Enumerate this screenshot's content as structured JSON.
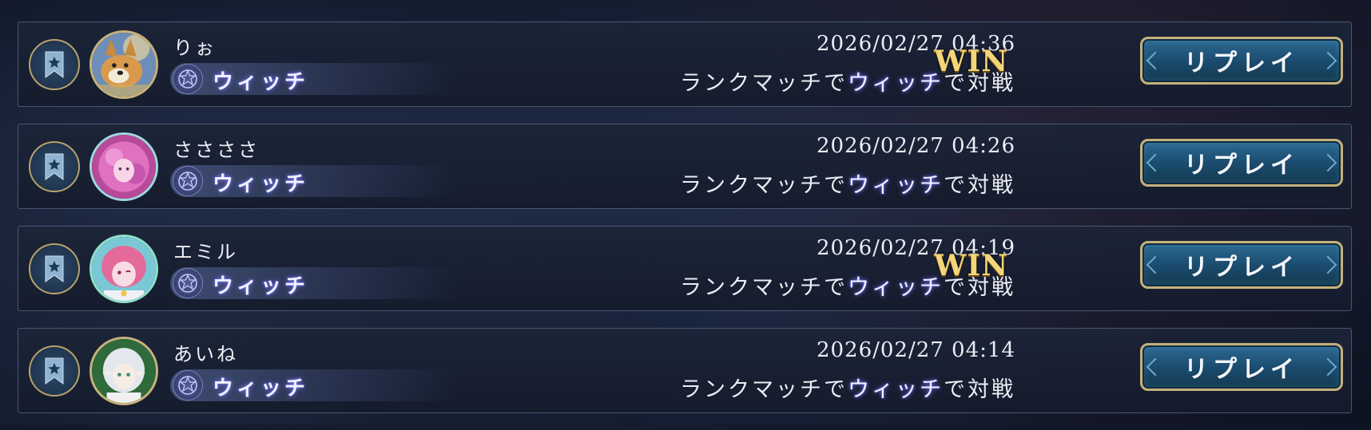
{
  "matches": [
    {
      "player": "りぉ",
      "class": "ウィッチ",
      "datetime": "2026/02/27 04:36",
      "match_prefix": "ランクマッチで",
      "match_class": "ウィッチ",
      "match_suffix": "で対戦",
      "result": "WIN",
      "replay_label": "リプレイ",
      "avatar": "corgi-avatar"
    },
    {
      "player": "ささささ",
      "class": "ウィッチ",
      "datetime": "2026/02/27 04:26",
      "match_prefix": "ランクマッチで",
      "match_class": "ウィッチ",
      "match_suffix": "で対戦",
      "result": "",
      "replay_label": "リプレイ",
      "avatar": "pink-hair-avatar"
    },
    {
      "player": "エミル",
      "class": "ウィッチ",
      "datetime": "2026/02/27 04:19",
      "match_prefix": "ランクマッチで",
      "match_class": "ウィッチ",
      "match_suffix": "で対戦",
      "result": "WIN",
      "replay_label": "リプレイ",
      "avatar": "pink-girl-avatar"
    },
    {
      "player": "あいね",
      "class": "ウィッチ",
      "datetime": "2026/02/27 04:14",
      "match_prefix": "ランクマッチで",
      "match_class": "ウィッチ",
      "match_suffix": "で対戦",
      "result": "",
      "replay_label": "リプレイ",
      "avatar": "white-hair-elf-avatar"
    }
  ],
  "colors": {
    "win": "#f3d67a",
    "class_glow": "#7f7cff",
    "button": "#1a4a6c",
    "gold_border": "#c6b07b"
  }
}
